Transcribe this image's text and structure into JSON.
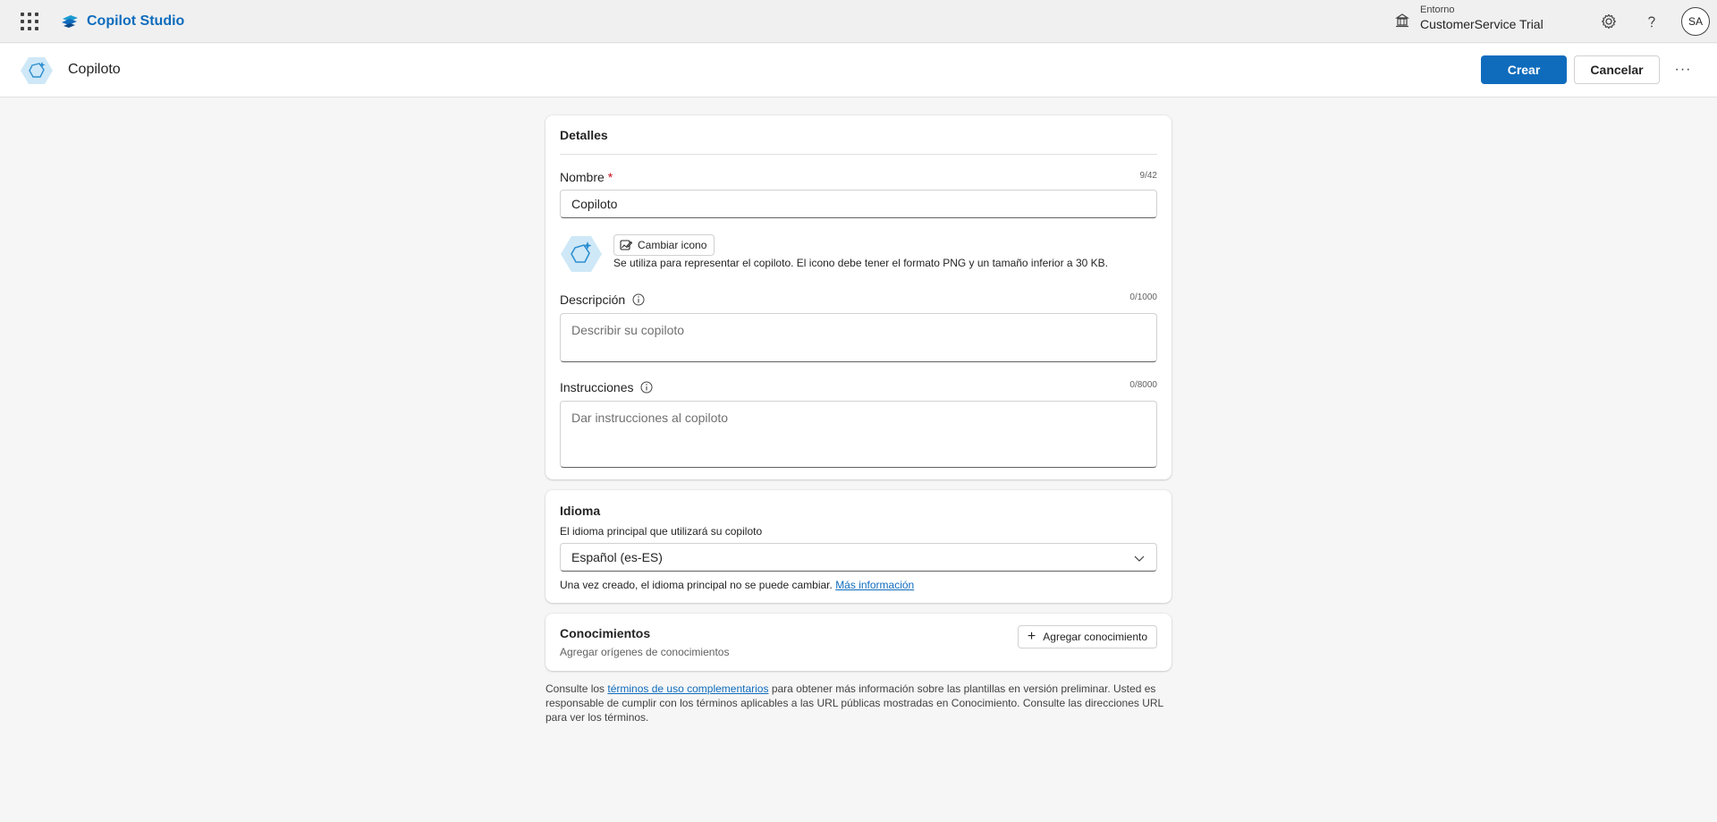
{
  "app": {
    "name": "Copilot Studio",
    "environment_label": "Entorno",
    "environment_name": "CustomerService Trial",
    "avatar_initials": "SA"
  },
  "header": {
    "title": "Copiloto",
    "create_label": "Crear",
    "cancel_label": "Cancelar",
    "more_label": "···"
  },
  "details": {
    "section_title": "Detalles",
    "name_label": "Nombre",
    "name_required_marker": "*",
    "name_counter": "9/42",
    "name_value": "Copiloto",
    "change_icon_label": "Cambiar icono",
    "icon_hint": "Se utiliza para representar el copiloto. El icono debe tener el formato PNG y un tamaño inferior a 30 KB.",
    "description_label": "Descripción",
    "description_counter": "0/1000",
    "description_placeholder": "Describir su copiloto",
    "instructions_label": "Instrucciones",
    "instructions_counter": "0/8000",
    "instructions_placeholder": "Dar instrucciones al copiloto"
  },
  "language": {
    "section_title": "Idioma",
    "subtitle": "El idioma principal que utilizará su copiloto",
    "selected": "Español (es-ES)",
    "note": "Una vez creado, el idioma principal no se puede cambiar.",
    "more_info_link": "Más información"
  },
  "knowledge": {
    "section_title": "Conocimientos",
    "subtitle": "Agregar orígenes de conocimientos",
    "add_label": "Agregar conocimiento"
  },
  "footer": {
    "prefix": "Consulte los",
    "link": "términos de uso complementarios",
    "suffix": "para obtener más información sobre las plantillas en versión preliminar. Usted es responsable de cumplir con los términos aplicables a las URL públicas mostradas en Conocimiento. Consulte las direcciones URL para ver los términos."
  },
  "colors": {
    "accent": "#0f6cbd",
    "required": "#c50f1f",
    "background": "#f6f6f6"
  },
  "icons": [
    "waffle-icon",
    "copilot-studio-logo",
    "environment-icon",
    "settings-icon",
    "help-icon",
    "copilot-hex-icon",
    "edit-image-icon",
    "info-icon",
    "chevron-down-icon",
    "plus-icon"
  ]
}
